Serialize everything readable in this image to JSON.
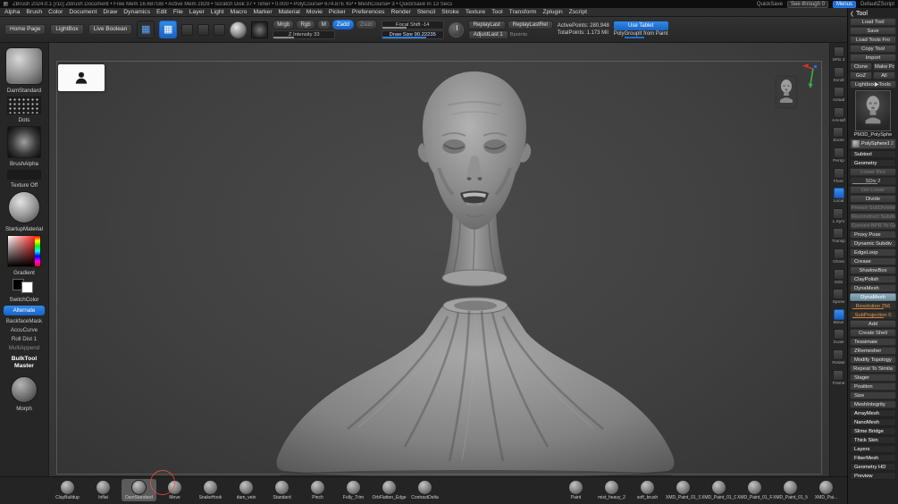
{
  "title_bar": {
    "app_info": "ZBrush 2024.0.1 [r1c]   ZBrush Document   • Free Mem 16.687GB   • Active Mem 2829   • Scratch Disk 37   • Timer • 0.000   • PolyCourse• 674.87E KP   • MeshCourse• 3   • QuickSave In 13 Secs",
    "quicksave": "QuickSave",
    "see_through": "See-through 0",
    "menus_button": "Menus",
    "zscript_button": "DefaultZScript"
  },
  "menu_bar": {
    "items": [
      "Alpha",
      "Brush",
      "Color",
      "Document",
      "Draw",
      "Dynamics",
      "Edit",
      "File",
      "Layer",
      "Light",
      "Macro",
      "Marker",
      "Material",
      "Movie",
      "Picker",
      "Preferences",
      "Render",
      "Stencil",
      "Stroke",
      "Texture",
      "Tool",
      "Transform",
      "Zplugin",
      "Zscript"
    ]
  },
  "toolbar": {
    "home_page": "Home Page",
    "lightbox": "LightBox",
    "live_boolean": "Live Boolean",
    "mrgb": "Mrgb",
    "rgb": "Rgb",
    "m": "M",
    "zadd": "Zadd",
    "zsub": "Zsub",
    "z_intensity": "Z Intensity 33",
    "focal_shift": "Focal Shift -14",
    "draw_size": "Draw Size 90.22235",
    "bpoints": "Bpoints",
    "replay_last": "ReplayLast",
    "replay_last_rel": "ReplayLastRel",
    "adjust_last": "AdjustLast 1",
    "active_points": "ActivePoints: 280,948",
    "total_points": "TotalPoints: 1.173 Mil",
    "use_tablet": "Use Tablet",
    "polygroupit": "PolyGroupIt from Paint"
  },
  "left_panel": {
    "brush_name": "DamStandard",
    "stroke_name": "Dots",
    "alpha_name": "BrushAlpha",
    "texture_name": "Texture Off",
    "material_name": "StartupMaterial",
    "gradient_name": "Gradient",
    "switch_color": "SwitchColor",
    "alternate": "Alternate",
    "items": [
      {
        "label": "BackfaceMask",
        "style": "norm"
      },
      {
        "label": "AccuCurve",
        "style": "norm"
      },
      {
        "label": "Roll Dist 1",
        "style": "norm"
      },
      {
        "label": "MultiAppend",
        "style": "dimtext"
      }
    ],
    "bulktool_line1": "BulkTool",
    "bulktool_line2": "Master",
    "morph_name": "Morph"
  },
  "right_shelf": {
    "items": [
      {
        "label": "SPix 3",
        "style": ""
      },
      {
        "label": "Scroll",
        "style": ""
      },
      {
        "label": "Actual",
        "style": ""
      },
      {
        "label": "AAHalf",
        "style": ""
      },
      {
        "label": "Zoom",
        "style": ""
      },
      {
        "label": "Persp",
        "style": ""
      },
      {
        "label": "Floor",
        "style": ""
      },
      {
        "label": "Local",
        "style": "on"
      },
      {
        "label": "L.Sym",
        "style": ""
      },
      {
        "label": "Transp",
        "style": ""
      },
      {
        "label": "Ghost",
        "style": ""
      },
      {
        "label": "Solo",
        "style": ""
      },
      {
        "label": "Xpose",
        "style": ""
      },
      {
        "label": "Move",
        "style": "on"
      },
      {
        "label": "Scale",
        "style": ""
      },
      {
        "label": "Rotate",
        "style": ""
      },
      {
        "label": "Frame",
        "style": ""
      }
    ]
  },
  "tool_panel": {
    "title": "Tool",
    "rows_top": [
      {
        "label": "Load Tool",
        "style": "btn"
      },
      {
        "label": "Save",
        "style": "btn"
      },
      {
        "label": "Load Tools Fro",
        "style": "btn"
      },
      {
        "label": "Copy Tool",
        "style": "btn"
      },
      {
        "label": "Import",
        "style": "btn"
      },
      {
        "label": "Clone",
        "style": "half"
      },
      {
        "label": "Make Po",
        "style": "half"
      },
      {
        "label": "GoZ",
        "style": "half"
      },
      {
        "label": "All",
        "style": "half"
      },
      {
        "label": "Lightbox▶Tools",
        "style": "btn"
      }
    ],
    "tool_name": "PM3D_PolySphe",
    "subtool_name": "PolySphere1",
    "subtool_count": "2",
    "rows": [
      {
        "label": "Subtool",
        "style": "header"
      },
      {
        "label": "Geometry",
        "style": "header"
      },
      {
        "label": "Lower Res",
        "style": "dim"
      },
      {
        "label": "SDiv 2",
        "style": "slider"
      },
      {
        "label": "Del Lower",
        "style": "dim"
      },
      {
        "label": "Divide",
        "style": "btn"
      },
      {
        "label": "Freeze SubDivision",
        "style": "dim"
      },
      {
        "label": "Reconstruct Subdiv",
        "style": "dim"
      },
      {
        "label": "Convert BPR To Geo",
        "style": "dim"
      },
      {
        "label": "Proxy Pose",
        "style": "section"
      },
      {
        "label": "Dynamic Subdiv",
        "style": "section"
      },
      {
        "label": "EdgeLoop",
        "style": "section"
      },
      {
        "label": "Crease",
        "style": "section"
      },
      {
        "label": "ShadowBox",
        "style": "btn"
      },
      {
        "label": "ClayPolish",
        "style": "section"
      },
      {
        "label": "DynaMesh",
        "style": "section"
      },
      {
        "label": "DynaMesh",
        "style": "active"
      },
      {
        "label": "Resolution 256",
        "style": "sliderOrange"
      },
      {
        "label": "SubProjection 0",
        "style": "sliderOrange"
      },
      {
        "label": "Add",
        "style": "btn"
      },
      {
        "label": "Create Shell",
        "style": "btn"
      },
      {
        "label": "Tessimate",
        "style": "section"
      },
      {
        "label": "ZRemesher",
        "style": "section"
      },
      {
        "label": "Modify Topology",
        "style": "section"
      },
      {
        "label": "Repeat To Simila",
        "style": "btn"
      },
      {
        "label": "Stager",
        "style": "section"
      },
      {
        "label": "Position",
        "style": "section"
      },
      {
        "label": "Size",
        "style": "section"
      },
      {
        "label": "MeshIntegrity",
        "style": "section"
      },
      {
        "label": "ArrayMesh",
        "style": "header"
      },
      {
        "label": "NanoMesh",
        "style": "header"
      },
      {
        "label": "Slime Bridge",
        "style": "header"
      },
      {
        "label": "Thick Skin",
        "style": "header"
      },
      {
        "label": "Layers",
        "style": "header"
      },
      {
        "label": "FiberMesh",
        "style": "header"
      },
      {
        "label": "Geometry HD",
        "style": "header"
      },
      {
        "label": "Preview",
        "style": "header"
      }
    ]
  },
  "brush_tray": {
    "left": [
      {
        "label": "ClayBuildup",
        "style": ""
      },
      {
        "label": "Inflat",
        "style": ""
      },
      {
        "label": "DamStandard",
        "style": "sel"
      },
      {
        "label": "Move",
        "style": ""
      },
      {
        "label": "SnakeHook",
        "style": ""
      },
      {
        "label": "dam_vein",
        "style": ""
      },
      {
        "label": "Standard",
        "style": ""
      },
      {
        "label": "Pinch",
        "style": ""
      },
      {
        "label": "Folly_Trim",
        "style": ""
      },
      {
        "label": "OrbFlatten_Edge",
        "style": ""
      },
      {
        "label": "ContrastDelta",
        "style": ""
      }
    ],
    "right": [
      {
        "label": "Paint",
        "style": ""
      },
      {
        "label": "mist_heavy_2",
        "style": ""
      },
      {
        "label": "soft_brush",
        "style": ""
      },
      {
        "label": "XMD_Paint_01_S",
        "style": ""
      },
      {
        "label": "XMD_Paint_01_C",
        "style": ""
      },
      {
        "label": "XMD_Paint_01_R",
        "style": ""
      },
      {
        "label": "XMD_Paint_01_N",
        "style": ""
      },
      {
        "label": "XMD_Pai...",
        "style": ""
      }
    ]
  },
  "icons": {
    "collapse": "❮",
    "grid": "▦"
  }
}
